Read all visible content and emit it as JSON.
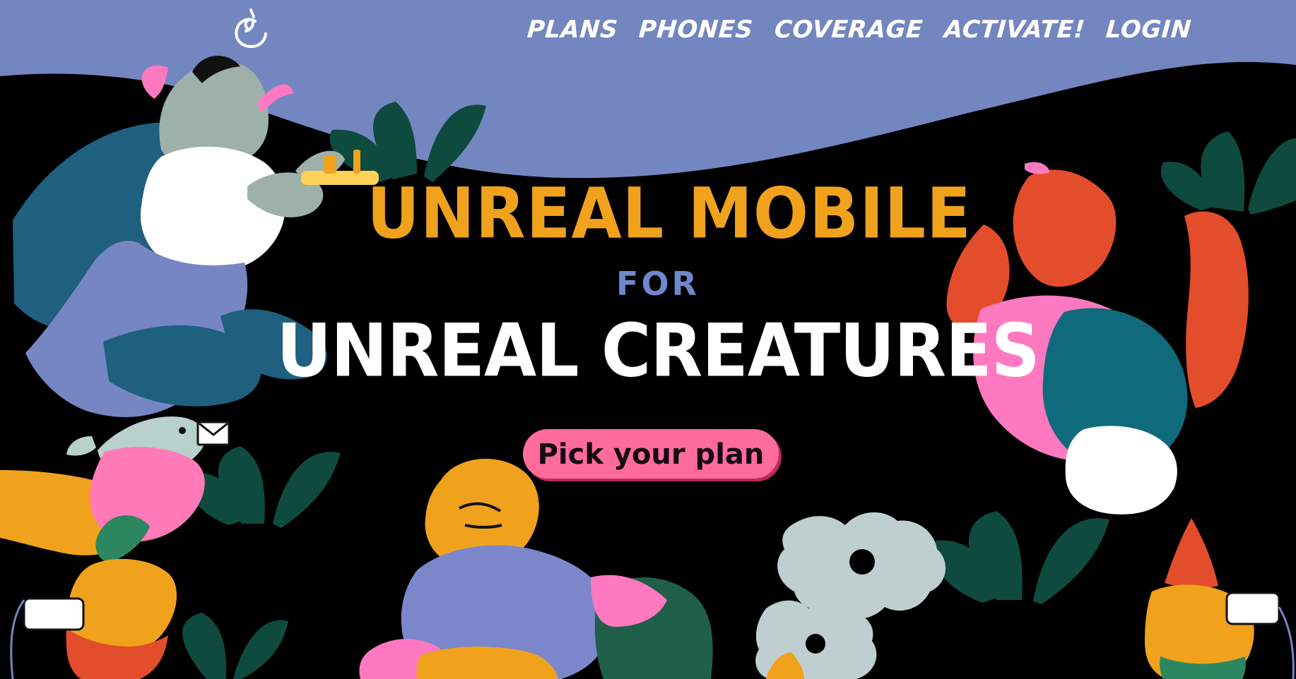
{
  "header": {
    "nav": [
      "PLANS",
      "PHONES",
      "COVERAGE",
      "ACTIVATE!",
      "LOGIN"
    ]
  },
  "hero": {
    "line1": "UNREAL MOBILE",
    "line2": "FOR",
    "line3": "UNREAL CREATURES",
    "cta": "Pick your plan"
  },
  "icons": [
    "unicorn-logo-icon",
    "vampire-icon",
    "werewolf-icon",
    "monster-icon",
    "gnome-icon",
    "dove-icon",
    "envelope-icon",
    "cloud-icon"
  ],
  "colors": {
    "background": "#000000",
    "sky": "#7486c0",
    "title_orange": "#f0a21d",
    "title_blue": "#6f87cc",
    "cta_pink": "#ff6b9b",
    "text_white": "#ffffff",
    "plant_green": "#0f4a3f"
  }
}
